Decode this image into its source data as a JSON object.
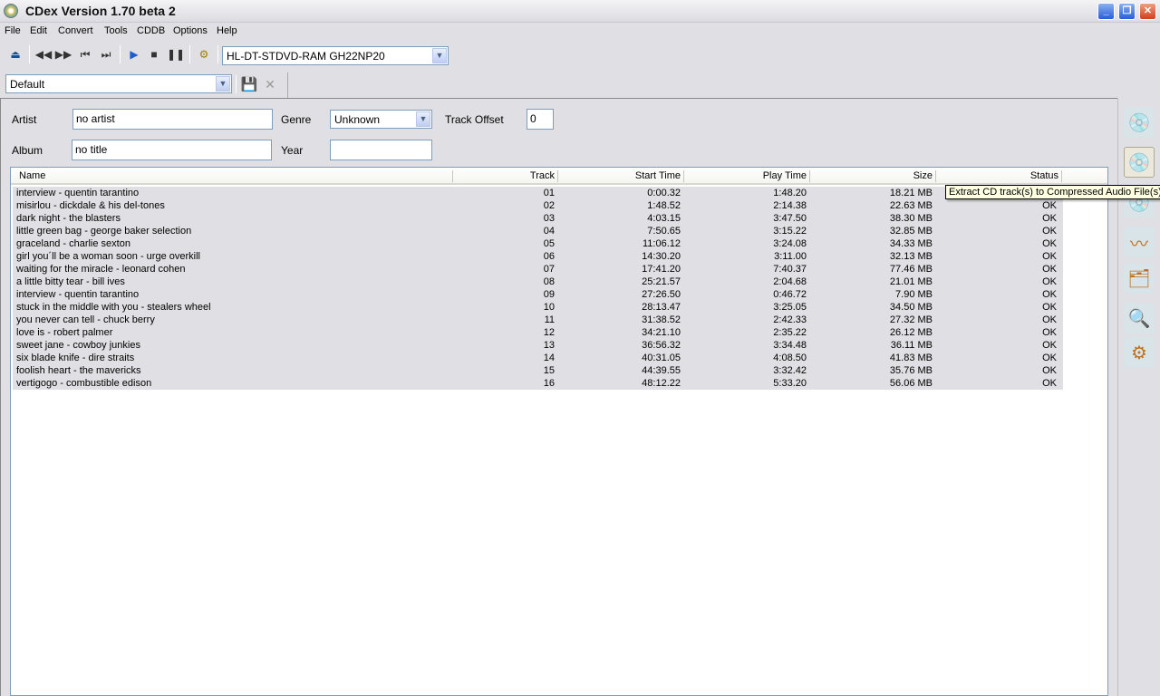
{
  "window": {
    "title": "CDex Version 1.70 beta 2"
  },
  "menu": [
    "File",
    "Edit",
    "Convert",
    "Tools",
    "CDDB",
    "Options",
    "Help"
  ],
  "toolbar": {
    "drive": "HL-DT-STDVD-RAM GH22NP20",
    "profile": "Default"
  },
  "form": {
    "artist_label": "Artist",
    "artist": "no artist",
    "album_label": "Album",
    "album": "no title",
    "genre_label": "Genre",
    "genre": "Unknown",
    "year_label": "Year",
    "year": "",
    "offset_label": "Track Offset",
    "offset": "0"
  },
  "table": {
    "columns": [
      "Name",
      "Track",
      "Start Time",
      "Play Time",
      "Size",
      "Status"
    ],
    "rows": [
      [
        "interview - quentin tarantino",
        "01",
        "0:00.32",
        "1:48.20",
        "18.21 MB",
        "OK"
      ],
      [
        "misirlou - dickdale & his del-tones",
        "02",
        "1:48.52",
        "2:14.38",
        "22.63 MB",
        "OK"
      ],
      [
        "dark night - the blasters",
        "03",
        "4:03.15",
        "3:47.50",
        "38.30 MB",
        "OK"
      ],
      [
        "little green bag - george baker selection",
        "04",
        "7:50.65",
        "3:15.22",
        "32.85 MB",
        "OK"
      ],
      [
        "graceland - charlie sexton",
        "05",
        "11:06.12",
        "3:24.08",
        "34.33 MB",
        "OK"
      ],
      [
        "girl you´ll be a woman soon - urge overkill",
        "06",
        "14:30.20",
        "3:11.00",
        "32.13 MB",
        "OK"
      ],
      [
        "waiting for the miracle - leonard cohen",
        "07",
        "17:41.20",
        "7:40.37",
        "77.46 MB",
        "OK"
      ],
      [
        "a little bitty tear - bill ives",
        "08",
        "25:21.57",
        "2:04.68",
        "21.01 MB",
        "OK"
      ],
      [
        "interview - quentin tarantino",
        "09",
        "27:26.50",
        "0:46.72",
        "7.90 MB",
        "OK"
      ],
      [
        "stuck in the middle with you - stealers wheel",
        "10",
        "28:13.47",
        "3:25.05",
        "34.50 MB",
        "OK"
      ],
      [
        "you never can tell - chuck berry",
        "11",
        "31:38.52",
        "2:42.33",
        "27.32 MB",
        "OK"
      ],
      [
        "love is - robert palmer",
        "12",
        "34:21.10",
        "2:35.22",
        "26.12 MB",
        "OK"
      ],
      [
        "sweet jane - cowboy junkies",
        "13",
        "36:56.32",
        "3:34.48",
        "36.11 MB",
        "OK"
      ],
      [
        "six blade knife - dire straits",
        "14",
        "40:31.05",
        "4:08.50",
        "41.83 MB",
        "OK"
      ],
      [
        "foolish heart - the mavericks",
        "15",
        "44:39.55",
        "3:32.42",
        "35.76 MB",
        "OK"
      ],
      [
        "vertigogo - combustible edison",
        "16",
        "48:12.22",
        "5:33.20",
        "56.06 MB",
        "OK"
      ]
    ]
  },
  "tooltip": "Extract CD track(s) to Compressed Audio File(s)",
  "side_buttons": [
    "extract-to-wav-icon",
    "extract-to-compressed-icon",
    "extract-partial-icon",
    "wav-to-compressed-icon",
    "compressed-to-wav-icon",
    "read-cd-info-icon",
    "settings-gear-icon"
  ]
}
